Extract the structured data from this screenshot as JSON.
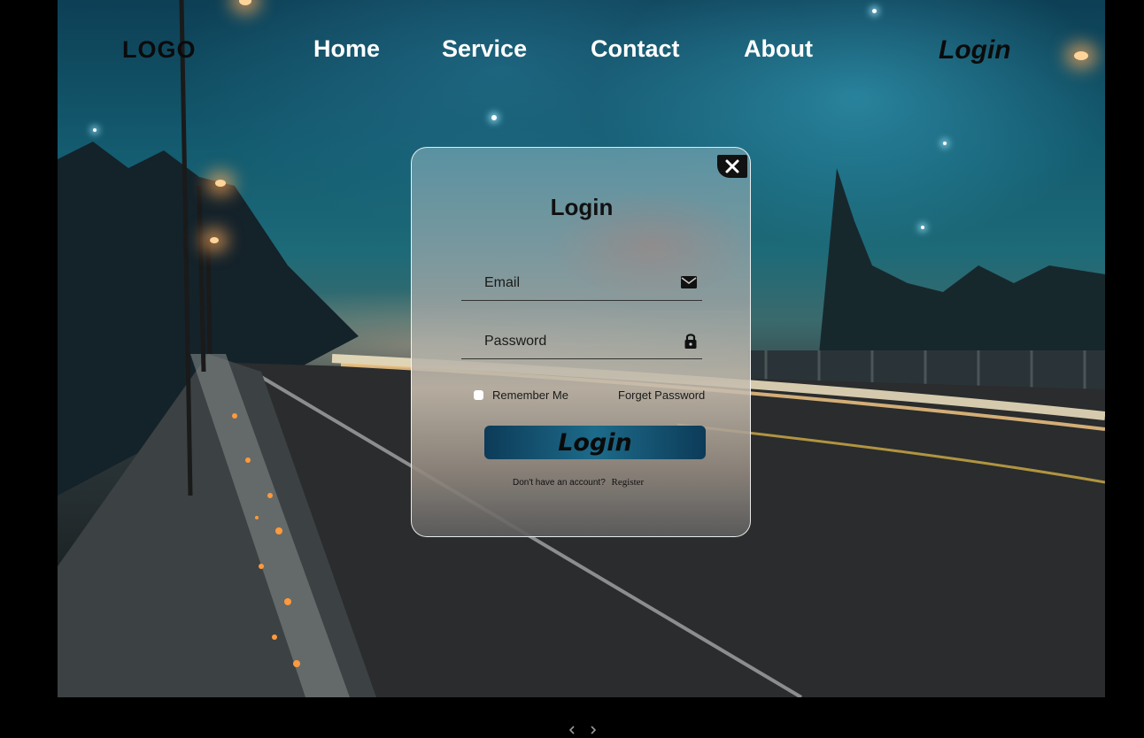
{
  "nav": {
    "logo": "LOGO",
    "links": [
      "Home",
      "Service",
      "Contact",
      "About"
    ],
    "login": "Login"
  },
  "dialog": {
    "title": "Login",
    "email_label": "Email",
    "password_label": "Password",
    "remember_label": "Remember Me",
    "forget_label": "Forget Password",
    "submit_label": "Login",
    "no_account_text": "Don't have an account?",
    "register_label": "Register"
  },
  "icons": {
    "close": "close-icon",
    "email": "envelope-icon",
    "password": "lock-icon"
  },
  "colors": {
    "button_gradient_dark": "#0c3b58",
    "button_gradient_light": "#1d6b8a"
  }
}
